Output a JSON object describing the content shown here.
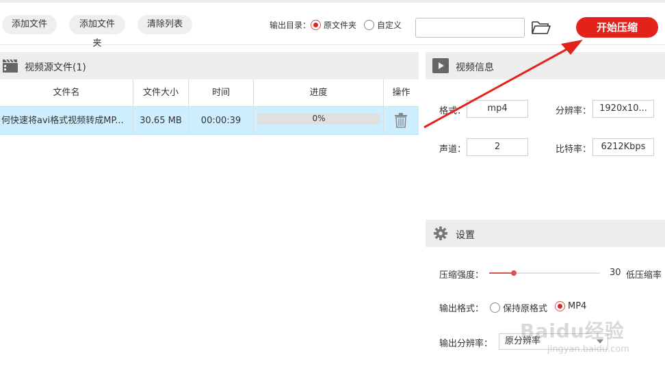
{
  "toolbar": {
    "add_file": "添加文件",
    "add_folder": "添加文件夹",
    "clear_list": "清除列表",
    "output_dir_label": "输出目录：",
    "radio_original": "原文件夹",
    "radio_custom": "自定义",
    "output_path": "",
    "start": "开始压缩"
  },
  "source": {
    "title": "视频源文件(1)",
    "columns": {
      "name": "文件名",
      "size": "文件大小",
      "time": "时间",
      "progress": "进度",
      "action": "操作"
    },
    "rows": [
      {
        "name": "何快速将avi格式视频转成MP...",
        "size": "30.65 MB",
        "time": "00:00:39",
        "progress_text": "0%",
        "progress_value": 0
      }
    ]
  },
  "info": {
    "title": "视频信息",
    "format_label": "格式：",
    "format_value": "mp4",
    "resolution_label": "分辨率：",
    "resolution_value": "1920x10...",
    "channels_label": "声道：",
    "channels_value": "2",
    "bitrate_label": "比特率：",
    "bitrate_value": "6212Kbps"
  },
  "settings": {
    "title": "设置",
    "strength_label": "压缩强度：",
    "strength_value": "30",
    "strength_fraction": 0.22,
    "strength_desc": "低压缩率",
    "format_label": "输出格式：",
    "format_keep": "保持原格式",
    "format_mp4": "MP4",
    "resolution_label": "输出分辨率：",
    "resolution_value": "原分辨率"
  },
  "watermark": {
    "text": "Baidu经验",
    "sub": "jingyan.baidu.com"
  },
  "colors": {
    "accent": "#e3231b",
    "selected_row": "#cdeeff",
    "header_bg": "#ededed"
  }
}
